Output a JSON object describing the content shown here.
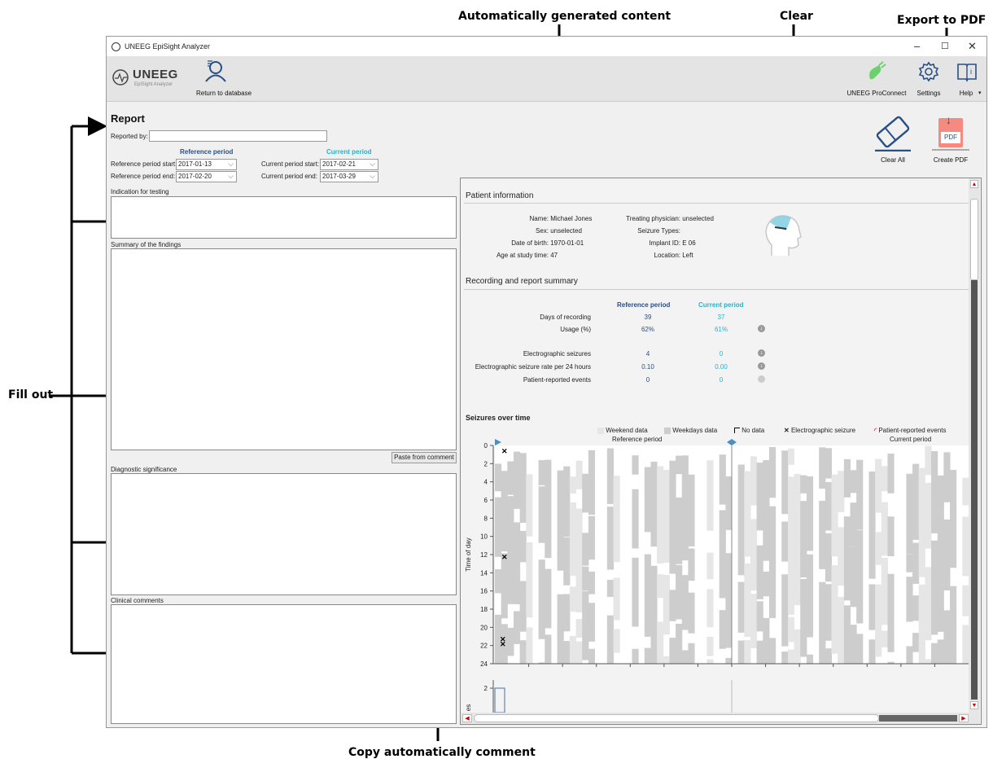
{
  "annotations": {
    "auto_content": "Automatically generated content",
    "clear": "Clear",
    "export_pdf": "Export to PDF",
    "fill_out": "Fill out",
    "copy_comment": "Copy automatically comment"
  },
  "window": {
    "title": "UNEEG EpiSight Analyzer",
    "minimize": "–",
    "maximize": "☐",
    "close": "✕"
  },
  "toolbar": {
    "logo_text": "UNEEG",
    "logo_sub": "EpiSight Analyzer",
    "return_label": "Return to database",
    "proconnect_label": "UNEEG ProConnect",
    "settings_label": "Settings",
    "help_label": "Help"
  },
  "report": {
    "title": "Report",
    "reported_by_label": "Reported by:",
    "reported_by_value": "",
    "ref_period_header": "Reference period",
    "cur_period_header": "Current period",
    "ref_start_label": "Reference period start:",
    "ref_start_value": "2017-01-13",
    "ref_end_label": "Reference period end:",
    "ref_end_value": "2017-02-20",
    "cur_start_label": "Current period start:",
    "cur_start_value": "2017-02-21",
    "cur_end_label": "Current period end:",
    "cur_end_value": "2017-03-29",
    "indication_label": "Indication for testing",
    "summary_label": "Summary of the findings",
    "paste_button": "Paste from comment",
    "diagnostic_label": "Diagnostic significance",
    "clinical_label": "Clinical comments"
  },
  "actions": {
    "clear_all": "Clear All",
    "create_pdf": "Create PDF",
    "pdf_icon_text": "PDF"
  },
  "patient": {
    "section_title": "Patient information",
    "name_label": "Name:",
    "name_value": "Michael Jones",
    "sex_label": "Sex:",
    "sex_value": "unselected",
    "dob_label": "Date of birth:",
    "dob_value": "1970-01-01",
    "age_label": "Age at study time:",
    "age_value": "47",
    "physician_label": "Treating physician:",
    "physician_value": "unselected",
    "seizure_types_label": "Seizure Types:",
    "seizure_types_value": "",
    "implant_label": "Implant ID:",
    "implant_value": "E 06",
    "location_label": "Location:",
    "location_value": "Left"
  },
  "summary": {
    "section_title": "Recording and report summary",
    "ref_header": "Reference period",
    "cur_header": "Current period",
    "rows": [
      {
        "label": "Days of recording",
        "ref": "39",
        "cur": "37",
        "trend": ""
      },
      {
        "label": "Usage (%)",
        "ref": "62%",
        "cur": "61%",
        "trend": "down"
      },
      {
        "label": "Electrographic seizures",
        "ref": "4",
        "cur": "0",
        "trend": "down"
      },
      {
        "label": "Electrographic seizure rate per 24 hours",
        "ref": "0.10",
        "cur": "0.00",
        "trend": "down"
      },
      {
        "label": "Patient-reported events",
        "ref": "0",
        "cur": "0",
        "trend": "neutral"
      }
    ]
  },
  "seizures_chart": {
    "title": "Seizures over time",
    "legend": {
      "weekend": "Weekend data",
      "weekdays": "Weekdays data",
      "no_data": "No data",
      "electro": "Electrographic seizure",
      "patient": "Patient-reported events"
    },
    "ref_label": "Reference period",
    "cur_label": "Current period",
    "ylabel": "Time of day",
    "yticks": [
      "0",
      "2",
      "4",
      "6",
      "8",
      "10",
      "12",
      "14",
      "16",
      "18",
      "20",
      "22",
      "24"
    ],
    "bottom_tick": "2",
    "bottom_ylabel": "es",
    "colors": {
      "weekend": "#e6e6e6",
      "weekdays": "#cdcdcd",
      "patient": "#e0307a",
      "marker": "#4a8fc4"
    }
  }
}
